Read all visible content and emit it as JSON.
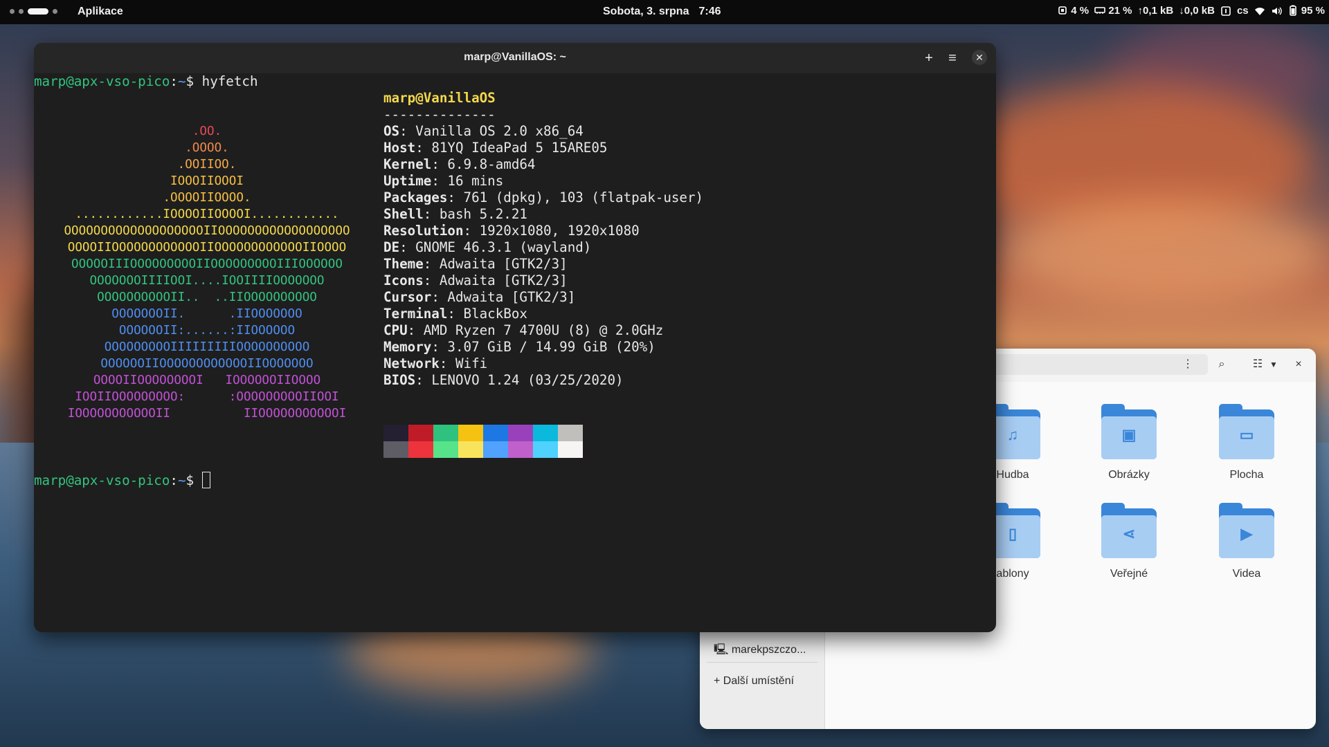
{
  "topbar": {
    "activities": "Aplikace",
    "date": "Sobota, 3. srpna",
    "time": "7:46",
    "cpu": "4 %",
    "memory": "21 %",
    "upload": "↑0,1 kB",
    "download": "↓0,0 kB",
    "keyboard": "cs",
    "battery": "95 %"
  },
  "terminal": {
    "title": "marp@VanillaOS: ~",
    "prompt_user": "marp@apx-vso-pico",
    "prompt_path": "~",
    "prompt_symbol": "$",
    "command": "hyfetch",
    "ascii_art": [
      ".OO.",
      ".OOOO.",
      ".OOIIOO.",
      "IOOOIIOOOI",
      ".OOOOIIOOOO.",
      "............IOOOOIIOOOOI............",
      "OOOOOOOOOOOOOOOOOOOIIOOOOOOOOOOOOOOOOOO",
      "OOOOIIOOOOOOOOOOOOIIOOOOOOOOOOOOIIOOOO",
      "OOOOOIIIOOOOOOOOOIIOOOOOOOOOIIIOOOOOO",
      "OOOOOOOIIIIOOI....IOOIIIIOOOOOOO",
      "OOOOOOOOOOII..  ..IIOOOOOOOOOO",
      "OOOOOOOII.      .IIOOOOOOO",
      "OOOOOOII:......:IIOOOOOO",
      "OOOOOOOOOIIIIIIIIIOOOOOOOOOO",
      "OOOOOOIIOOOOOOOOOOOOIIOOOOOOO",
      "OOOOIIOOOOOOOOI   IOOOOOOIIOOOO",
      "IOOIIOOOOOOOOO:      :OOOOOOOOOIIOOI",
      "IOOOOOOOOOOOII          IIOOOOOOOOOOOI"
    ],
    "ascii_colors": [
      "#e8495a",
      "#f08a4b",
      "#f4a94a",
      "#f6c043",
      "#f6c043",
      "#f3d84b",
      "#f3d84b",
      "#f3d84b",
      "#33c47f",
      "#33c47f",
      "#33c47f",
      "#4f8ef0",
      "#4f8ef0",
      "#4f8ef0",
      "#4f8ef0",
      "#c251d6",
      "#c251d6",
      "#c251d6"
    ],
    "host_line": "marp@VanillaOS",
    "separator": "--------------",
    "info": [
      {
        "key": "OS",
        "value": ": Vanilla OS 2.0 x86_64"
      },
      {
        "key": "Host",
        "value": ": 81YQ IdeaPad 5 15ARE05"
      },
      {
        "key": "Kernel",
        "value": ": 6.9.8-amd64"
      },
      {
        "key": "Uptime",
        "value": ": 16 mins"
      },
      {
        "key": "Packages",
        "value": ": 761 (dpkg), 103 (flatpak-user)"
      },
      {
        "key": "Shell",
        "value": ": bash 5.2.21"
      },
      {
        "key": "Resolution",
        "value": ": 1920x1080, 1920x1080"
      },
      {
        "key": "DE",
        "value": ": GNOME 46.3.1 (wayland)"
      },
      {
        "key": "Theme",
        "value": ": Adwaita [GTK2/3]"
      },
      {
        "key": "Icons",
        "value": ": Adwaita [GTK2/3]"
      },
      {
        "key": "Cursor",
        "value": ": Adwaita [GTK2/3]"
      },
      {
        "key": "Terminal",
        "value": ": BlackBox"
      },
      {
        "key": "CPU",
        "value": ": AMD Ryzen 7 4700U (8) @ 2.0GHz"
      },
      {
        "key": "Memory",
        "value": ": 3.07 GiB / 14.99 GiB (20%)"
      },
      {
        "key": "Network",
        "value": ": Wifi"
      },
      {
        "key": "BIOS",
        "value": ": LENOVO 1.24 (03/25/2020)"
      }
    ],
    "palette_dark": [
      "#241f31",
      "#c01c28",
      "#2ec27e",
      "#f5c211",
      "#1e78e4",
      "#9841bb",
      "#0ab9dc",
      "#c0bfbc"
    ],
    "palette_bright": [
      "#5e5c64",
      "#ed333b",
      "#57e389",
      "#f8e45c",
      "#51a1ff",
      "#c061cb",
      "#4fd2fd",
      "#f6f5f4"
    ]
  },
  "files": {
    "sidebar": [
      "marekpszczo...",
      "+ Další umístění"
    ],
    "folders": [
      {
        "label": "Hudba",
        "icon": "music-icon",
        "symbol": "♫"
      },
      {
        "label": "Obrázky",
        "icon": "image-icon",
        "symbol": "▣"
      },
      {
        "label": "Plocha",
        "icon": "desktop-folder-icon",
        "symbol": "▭"
      },
      {
        "label": "ablony",
        "icon": "template-icon",
        "symbol": "▯"
      },
      {
        "label": "Veřejné",
        "icon": "share-icon",
        "symbol": "⋖"
      },
      {
        "label": "Videa",
        "icon": "video-icon",
        "symbol": "▶"
      }
    ]
  }
}
